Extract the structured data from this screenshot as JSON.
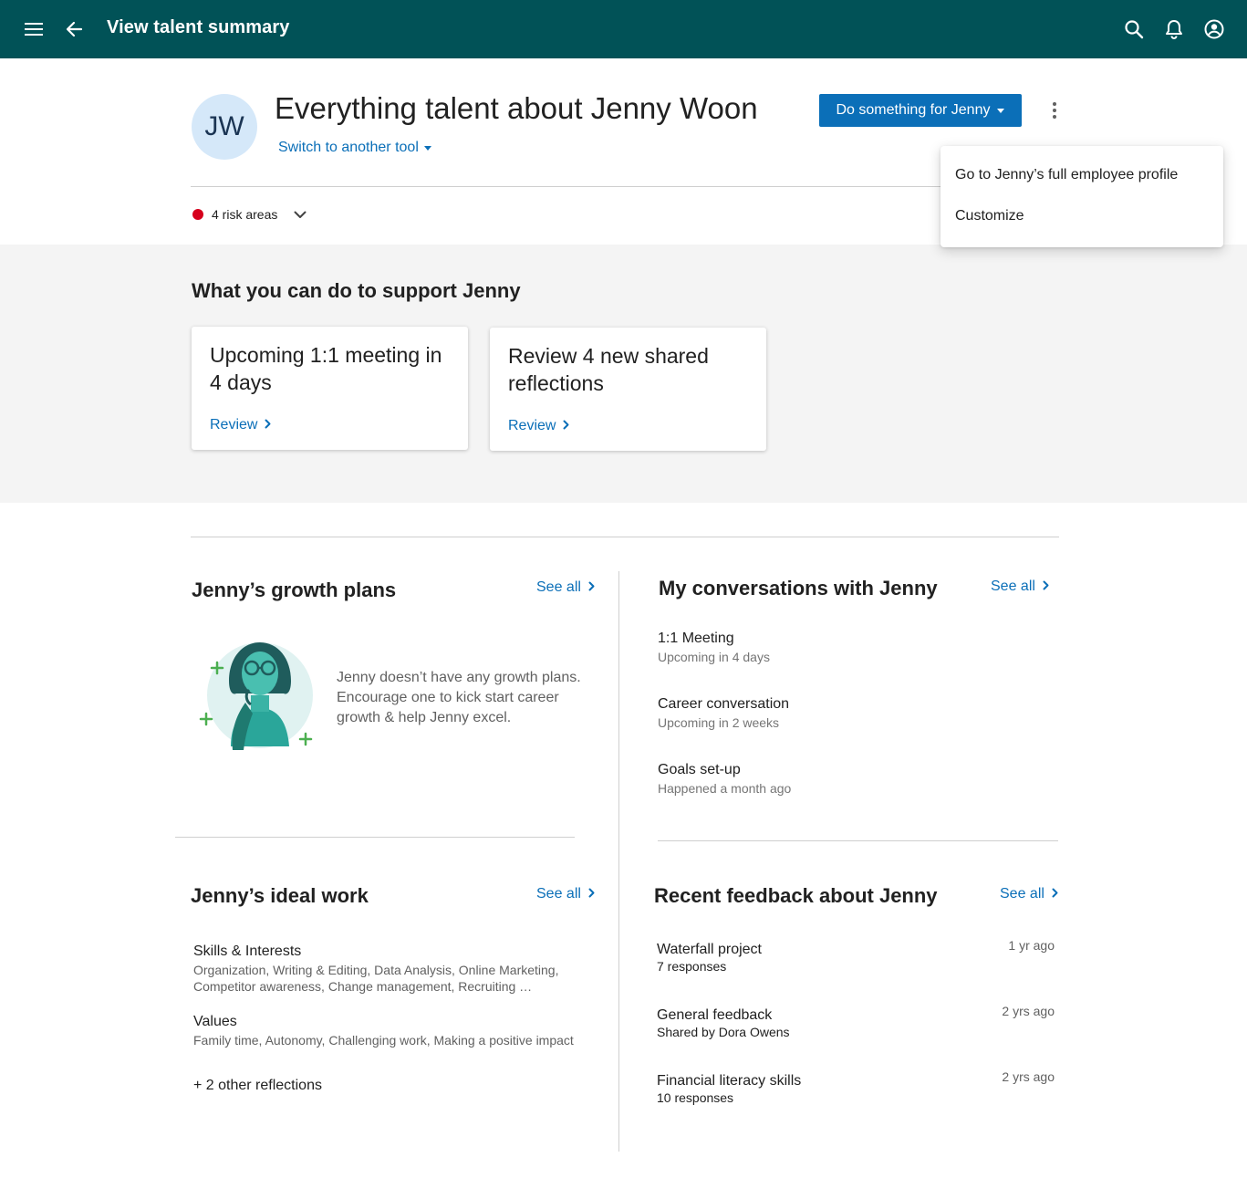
{
  "appbar": {
    "title": "View talent summary",
    "icons": [
      "menu-icon",
      "back-arrow-icon",
      "search-icon",
      "bell-icon",
      "account-circle-icon"
    ]
  },
  "header": {
    "avatar_initials": "JW",
    "title": "Everything talent about Jenny Woon",
    "switch_tool": "Switch to another tool",
    "primary_action": "Do something for Jenny",
    "risk_label": "4 risk areas"
  },
  "overflow_menu": {
    "items": [
      "Go to Jenny’s full employee profile",
      "Customize"
    ]
  },
  "support": {
    "title": "What you can do to support Jenny",
    "cards": [
      {
        "text": "Upcoming 1:1 meeting in 4 days",
        "link": "Review"
      },
      {
        "text": "Review 4 new shared reflections",
        "link": "Review"
      }
    ]
  },
  "growth_plans": {
    "title": "Jenny’s growth plans",
    "see_all": "See all",
    "empty_text": "Jenny doesn’t have any growth plans. Encourage one to kick start career growth & help Jenny excel."
  },
  "conversations": {
    "title": "My conversations with Jenny",
    "see_all": "See all",
    "items": [
      {
        "title": "1:1 Meeting",
        "subtitle": "Upcoming in 4 days"
      },
      {
        "title": "Career conversation",
        "subtitle": "Upcoming in 2 weeks"
      },
      {
        "title": "Goals set-up",
        "subtitle": "Happened a month ago"
      }
    ]
  },
  "ideal_work": {
    "title": "Jenny’s ideal work",
    "see_all": "See all",
    "skills_label": "Skills & Interests",
    "skills_value": "Organization, Writing & Editing, Data Analysis, Online Marketing, Competitor awareness, Change management, Recruiting …",
    "values_label": "Values",
    "values_value": "Family time, Autonomy, Challenging work, Making a positive impact",
    "other": "+ 2 other reflections"
  },
  "feedback": {
    "title": "Recent feedback about Jenny",
    "see_all": "See all",
    "items": [
      {
        "title": "Waterfall project",
        "subtitle": "7 responses",
        "time": "1 yr ago"
      },
      {
        "title": "General feedback",
        "subtitle": "Shared by Dora Owens",
        "time": "2 yrs ago"
      },
      {
        "title": "Financial literacy skills",
        "subtitle": "10 responses",
        "time": "2 yrs ago"
      }
    ]
  },
  "colors": {
    "appbar": "#015257",
    "primary": "#0b6fb8",
    "risk": "#d6001c",
    "support_bg": "#f4f4f4",
    "avatar_bg": "#d5e8f9"
  }
}
